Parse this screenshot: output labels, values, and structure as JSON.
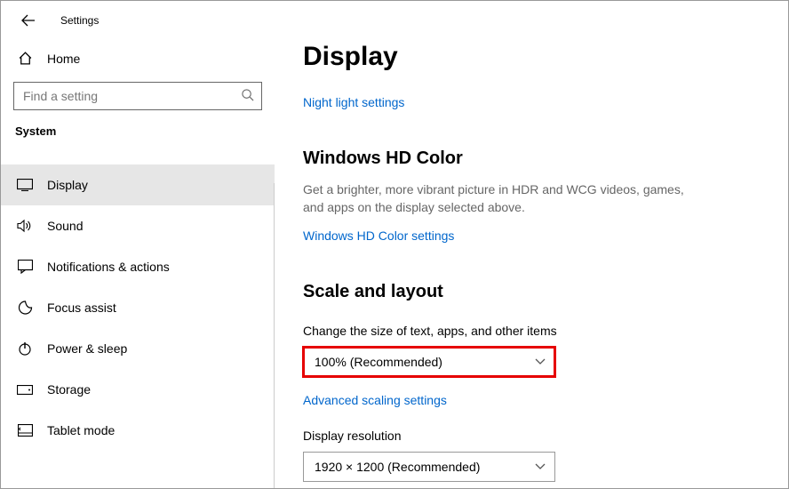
{
  "window": {
    "title": "Settings"
  },
  "sidebar": {
    "home_label": "Home",
    "search_placeholder": "Find a setting",
    "section_label": "System",
    "items": [
      {
        "label": "Display"
      },
      {
        "label": "Sound"
      },
      {
        "label": "Notifications & actions"
      },
      {
        "label": "Focus assist"
      },
      {
        "label": "Power & sleep"
      },
      {
        "label": "Storage"
      },
      {
        "label": "Tablet mode"
      }
    ]
  },
  "content": {
    "title": "Display",
    "night_light_link": "Night light settings",
    "hd_color": {
      "heading": "Windows HD Color",
      "desc": "Get a brighter, more vibrant picture in HDR and WCG videos, games, and apps on the display selected above.",
      "link": "Windows HD Color settings"
    },
    "scale": {
      "heading": "Scale and layout",
      "field_label": "Change the size of text, apps, and other items",
      "dropdown_value": "100% (Recommended)",
      "link": "Advanced scaling settings"
    },
    "resolution": {
      "field_label": "Display resolution",
      "dropdown_value": "1920 × 1200 (Recommended)"
    }
  }
}
